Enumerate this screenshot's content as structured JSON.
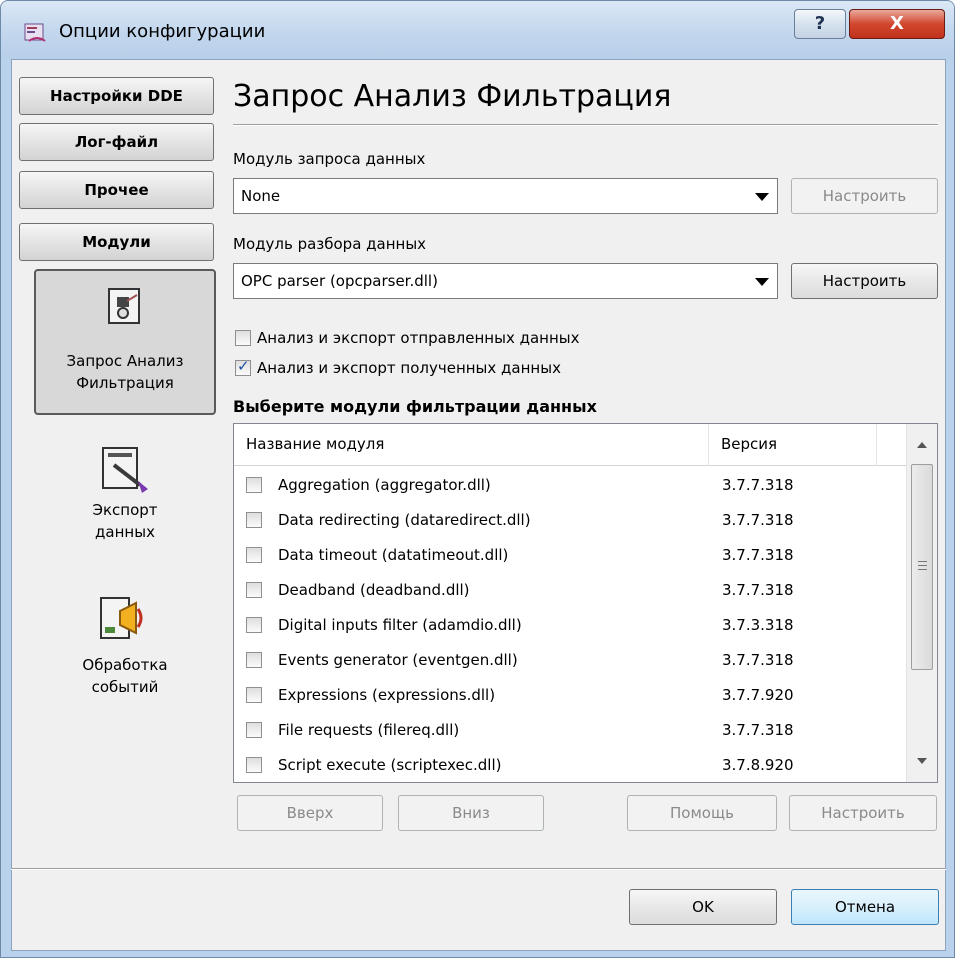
{
  "window": {
    "title": "Опции конфигурации",
    "help_label": "?",
    "close_label": "X"
  },
  "categories": [
    {
      "label": "Настройки DDE"
    },
    {
      "label": "Лог-файл"
    },
    {
      "label": "Прочее"
    },
    {
      "label": "Модули"
    }
  ],
  "modules": [
    {
      "label_line1": "Запрос Анализ",
      "label_line2": "Фильтрация",
      "icon": "request-analysis-icon",
      "selected": true
    },
    {
      "label_line1": "Экспорт",
      "label_line2": "данных",
      "icon": "data-export-icon",
      "selected": false
    },
    {
      "label_line1": "Обработка",
      "label_line2": "событий",
      "icon": "event-processing-icon",
      "selected": false
    }
  ],
  "page": {
    "title": "Запрос Анализ Фильтрация",
    "request_module_label": "Модуль запроса данных",
    "request_module_value": "None",
    "request_configure_label": "Настроить",
    "parse_module_label": "Модуль разбора данных",
    "parse_module_value": "OPC parser (opcparser.dll)",
    "parse_configure_label": "Настроить",
    "check_sent_label": "Анализ и экспорт отправленных данных",
    "check_sent_checked": false,
    "check_received_label": "Анализ и экспорт полученных данных",
    "check_received_checked": true,
    "filter_section_label": "Выберите модули фильтрации данных"
  },
  "filter_list": {
    "columns": [
      "Название модуля",
      "Версия"
    ],
    "rows": [
      {
        "name": "Aggregation (aggregator.dll)",
        "version": "3.7.7.318",
        "checked": false
      },
      {
        "name": "Data redirecting (dataredirect.dll)",
        "version": "3.7.7.318",
        "checked": false
      },
      {
        "name": "Data timeout (datatimeout.dll)",
        "version": "3.7.7.318",
        "checked": false
      },
      {
        "name": "Deadband (deadband.dll)",
        "version": "3.7.7.318",
        "checked": false
      },
      {
        "name": "Digital inputs filter (adamdio.dll)",
        "version": "3.7.3.318",
        "checked": false
      },
      {
        "name": "Events generator (eventgen.dll)",
        "version": "3.7.7.318",
        "checked": false
      },
      {
        "name": "Expressions (expressions.dll)",
        "version": "3.7.7.920",
        "checked": false
      },
      {
        "name": "File requests (filereq.dll)",
        "version": "3.7.7.318",
        "checked": false
      },
      {
        "name": "Script execute (scriptexec.dll)",
        "version": "3.7.8.920",
        "checked": false
      }
    ]
  },
  "list_buttons": {
    "up_label": "Вверх",
    "down_label": "Вниз",
    "help_label": "Помощь",
    "configure_label": "Настроить"
  },
  "footer": {
    "ok_label": "OK",
    "cancel_label": "Отмена"
  },
  "colors": {
    "window_frame": "#b9d1ea",
    "close_button": "#c9402b",
    "dialog_bg": "#f0f0f0"
  }
}
